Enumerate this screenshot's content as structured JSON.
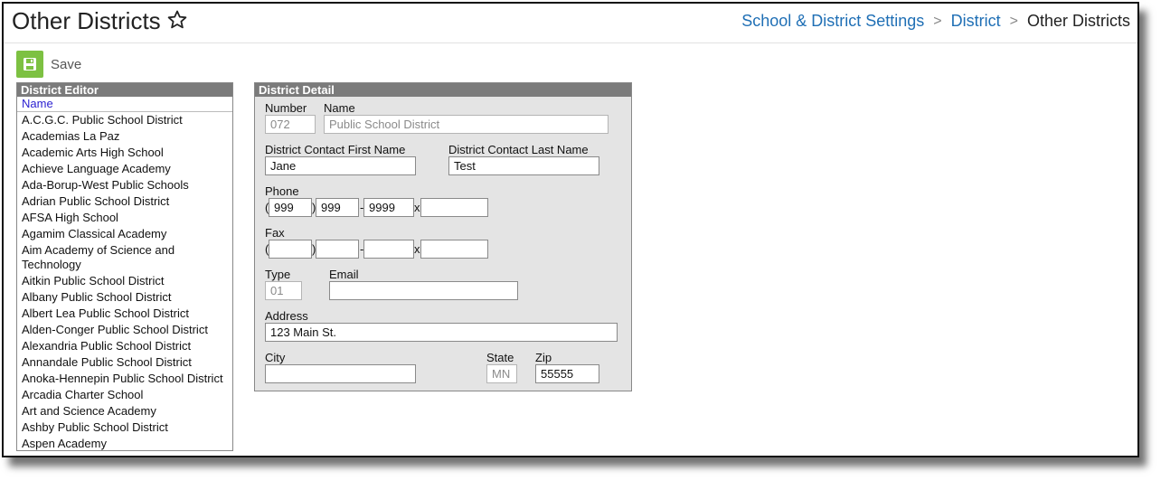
{
  "header": {
    "title": "Other Districts",
    "breadcrumb": [
      "School & District Settings",
      "District",
      "Other Districts"
    ],
    "separator": ">"
  },
  "toolbar": {
    "save_label": "Save"
  },
  "editor": {
    "title": "District Editor",
    "column_header": "Name",
    "items": [
      "A.C.G.C. Public School District",
      "Academias La Paz",
      "Academic Arts High School",
      "Achieve Language Academy",
      "Ada-Borup-West Public Schools",
      "Adrian Public School District",
      "AFSA High School",
      "Agamim Classical Academy",
      "Aim Academy of Science and Technology",
      "Aitkin Public School District",
      "Albany Public School District",
      "Albert Lea Public School District",
      "Alden-Conger Public School District",
      "Alexandria Public School District",
      "Annandale Public School District",
      "Anoka-Hennepin Public School District",
      "Arcadia Charter School",
      "Art and Science Academy",
      "Ashby Public School District",
      "Aspen Academy"
    ]
  },
  "detail": {
    "title": "District Detail",
    "labels": {
      "number": "Number",
      "name": "Name",
      "contact_first": "District Contact First Name",
      "contact_last": "District Contact Last Name",
      "phone": "Phone",
      "fax": "Fax",
      "type": "Type",
      "email": "Email",
      "address": "Address",
      "city": "City",
      "state": "State",
      "zip": "Zip"
    },
    "values": {
      "number": "072",
      "name": "Public School District",
      "contact_first": "Jane",
      "contact_last": "Test",
      "phone_area": "999",
      "phone_prefix": "999",
      "phone_line": "9999",
      "phone_ext": "",
      "fax_area": "",
      "fax_prefix": "",
      "fax_line": "",
      "fax_ext": "",
      "type": "01",
      "email": "",
      "address": "123 Main St.",
      "city": "",
      "state": "MN",
      "zip": "55555"
    },
    "phone_symbols": {
      "open": "(",
      "close": ")",
      "dash": "-",
      "ext": "x"
    }
  },
  "colors": {
    "link": "#1f6fb5",
    "save_green": "#7dc142",
    "panel_header": "#7b7b7b",
    "panel_bg": "#e4e4e4",
    "column_header": "#2a1fd0"
  }
}
